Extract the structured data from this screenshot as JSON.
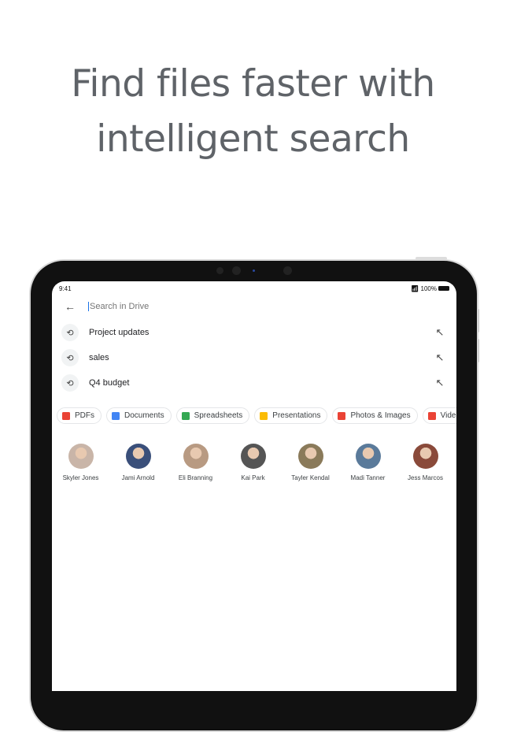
{
  "headline": {
    "line1": "Find files faster with",
    "line2": "intelligent search"
  },
  "status": {
    "time": "9:41",
    "battery": "100%"
  },
  "search": {
    "placeholder": "Search in Drive"
  },
  "recent": [
    {
      "label": "Project updates"
    },
    {
      "label": "sales"
    },
    {
      "label": "Q4 budget"
    }
  ],
  "chips": [
    {
      "label": "PDFs",
      "color": "#ea4335"
    },
    {
      "label": "Documents",
      "color": "#4285f4"
    },
    {
      "label": "Spreadsheets",
      "color": "#34a853"
    },
    {
      "label": "Presentations",
      "color": "#fbbc04"
    },
    {
      "label": "Photos & Images",
      "color": "#ea4335"
    },
    {
      "label": "Videos",
      "color": "#ea4335"
    }
  ],
  "people": [
    {
      "name": "Skyler Jones",
      "color": "#c9b5a8"
    },
    {
      "name": "Jami Arnold",
      "color": "#3a4f7a"
    },
    {
      "name": "Eli Branning",
      "color": "#b89a82"
    },
    {
      "name": "Kai Park",
      "color": "#555555"
    },
    {
      "name": "Tayler Kendal",
      "color": "#8a7a5a"
    },
    {
      "name": "Madi Tanner",
      "color": "#5a7a9a"
    },
    {
      "name": "Jess Marcos",
      "color": "#8a4a3a"
    }
  ]
}
